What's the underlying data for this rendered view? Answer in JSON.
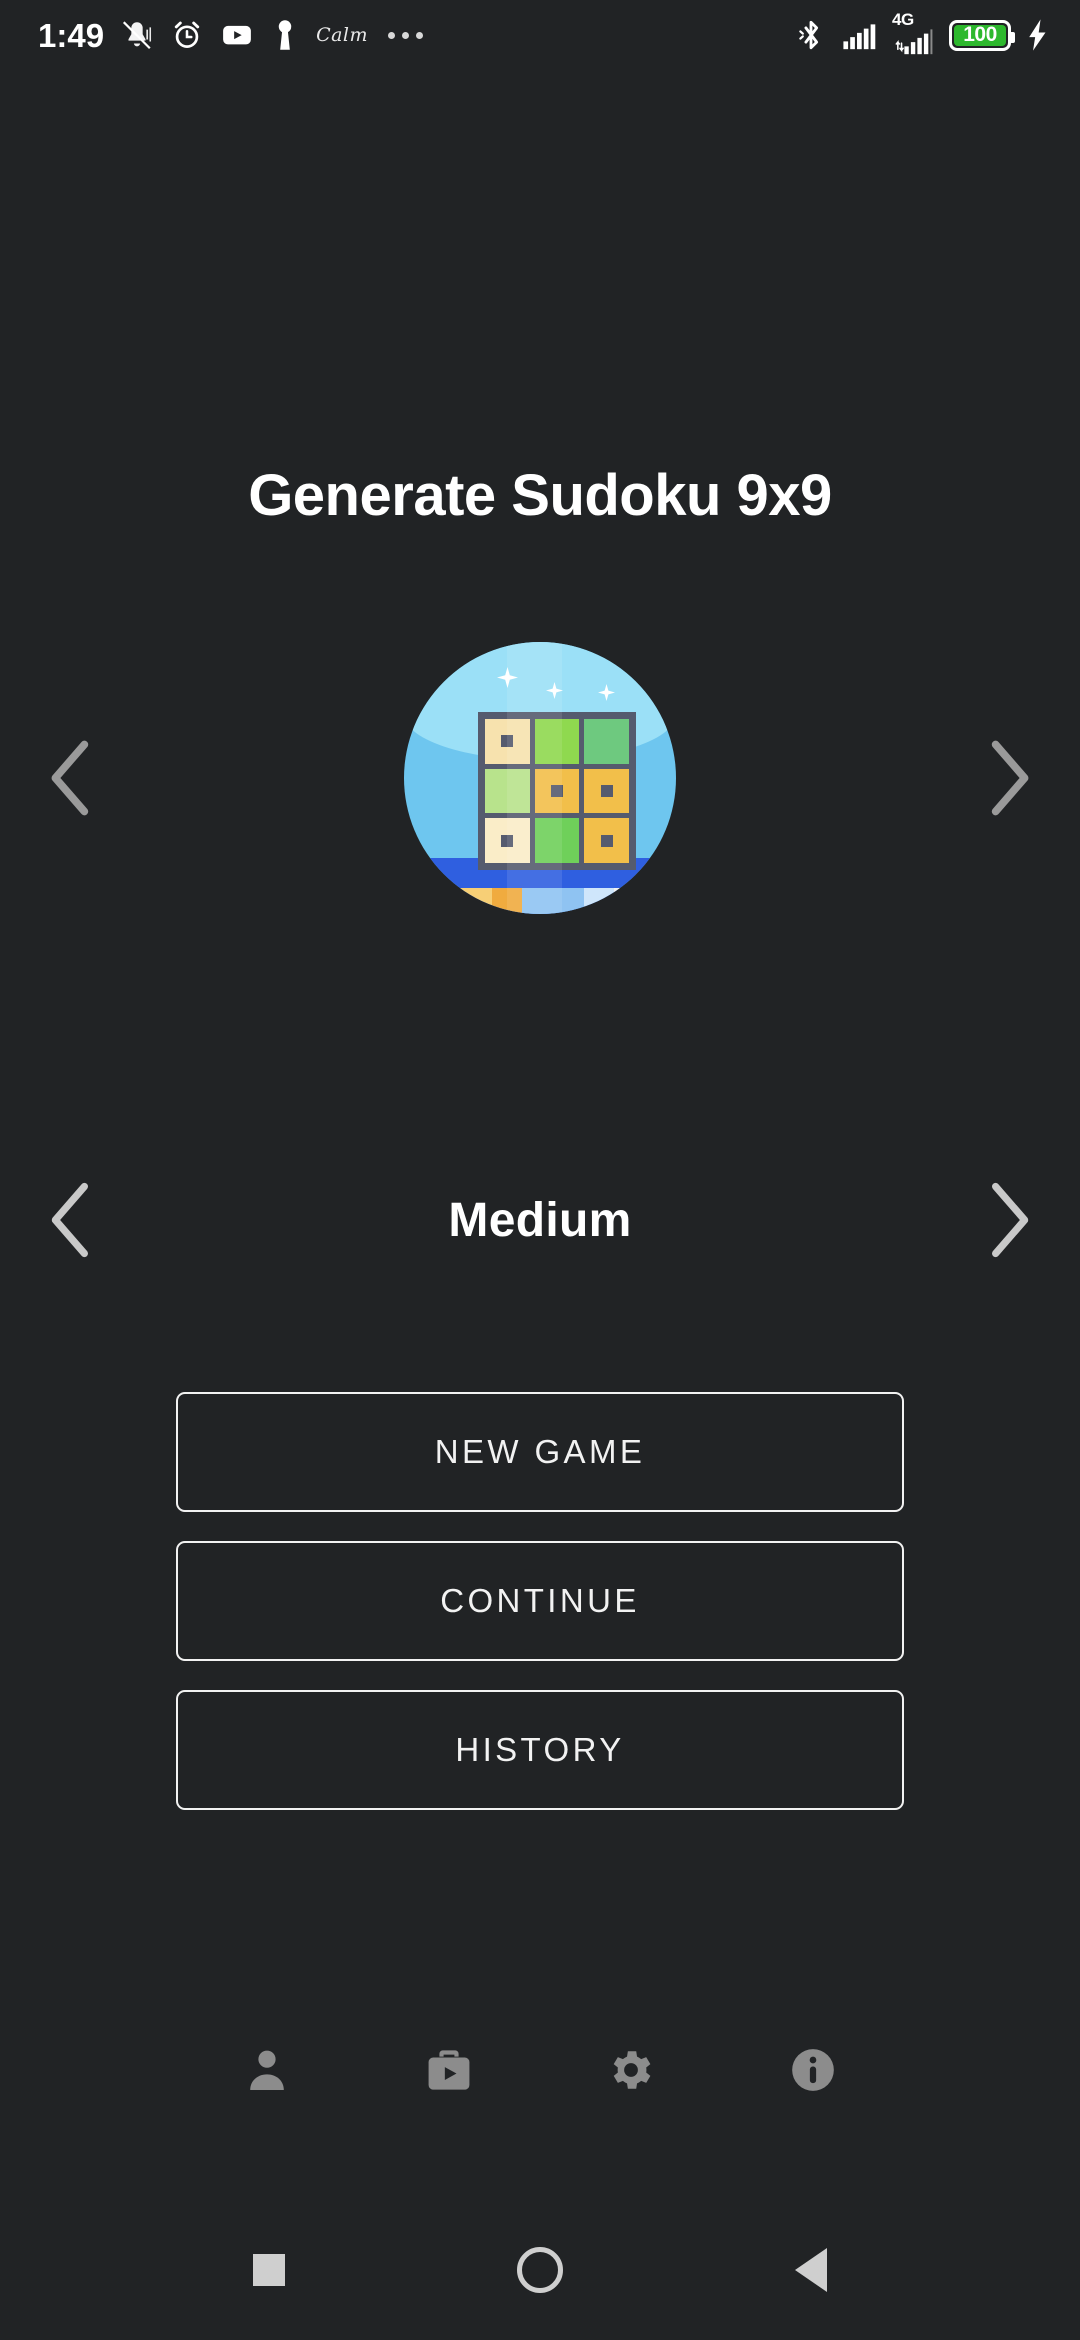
{
  "status_bar": {
    "time": "1:49",
    "calm_label": "Calm",
    "battery_percent": "100",
    "network_type": "4G",
    "left_icons": [
      "vibrate-off-icon",
      "alarm-icon",
      "youtube-icon",
      "keyhole-icon"
    ],
    "right_icons": [
      "bluetooth-icon",
      "signal-icon",
      "signal-4g-icon",
      "battery-icon",
      "charging-bolt-icon"
    ],
    "overflow": "more-dots-icon",
    "colors": {
      "battery_green": "#2db82d",
      "text": "#ffffff"
    }
  },
  "header": {
    "title": "Generate Sudoku 9x9"
  },
  "variant_carousel": {
    "prev_label": "chevron-left-icon",
    "next_label": "chevron-right-icon",
    "app_icon": {
      "name": "sudoku-app-icon",
      "sky_color": "#9be0f7",
      "water_color": "#6ec6ef",
      "sea_color": "#2f5fe0",
      "grid_color": "#555b6e",
      "cells": [
        {
          "color": "#f7e2ae",
          "dot": true
        },
        {
          "color": "#8fd94f",
          "dot": false
        },
        {
          "color": "#6ec97f",
          "dot": false
        },
        {
          "color": "#b8e38c",
          "dot": false
        },
        {
          "color": "#f2bf4a",
          "dot": true
        },
        {
          "color": "#f2bf4a",
          "dot": true
        },
        {
          "color": "#faedc8",
          "dot": true
        },
        {
          "color": "#6fd05a",
          "dot": false
        },
        {
          "color": "#f2bf4a",
          "dot": true
        }
      ]
    }
  },
  "difficulty_carousel": {
    "prev_label": "chevron-left-icon",
    "value": "Medium",
    "next_label": "chevron-right-icon"
  },
  "menu": {
    "buttons": [
      {
        "label": "NEW GAME",
        "name": "new-game-button"
      },
      {
        "label": "CONTINUE",
        "name": "continue-button"
      },
      {
        "label": "HISTORY",
        "name": "history-button"
      }
    ]
  },
  "icon_bar": {
    "items": [
      {
        "name": "profile-icon"
      },
      {
        "name": "store-icon"
      },
      {
        "name": "settings-gear-icon"
      },
      {
        "name": "info-icon"
      }
    ],
    "color": "#8c8c8c"
  },
  "android_nav": {
    "items": [
      {
        "name": "recents-square-button"
      },
      {
        "name": "home-circle-button"
      },
      {
        "name": "back-triangle-button"
      }
    ],
    "color": "#cfcfcf"
  }
}
